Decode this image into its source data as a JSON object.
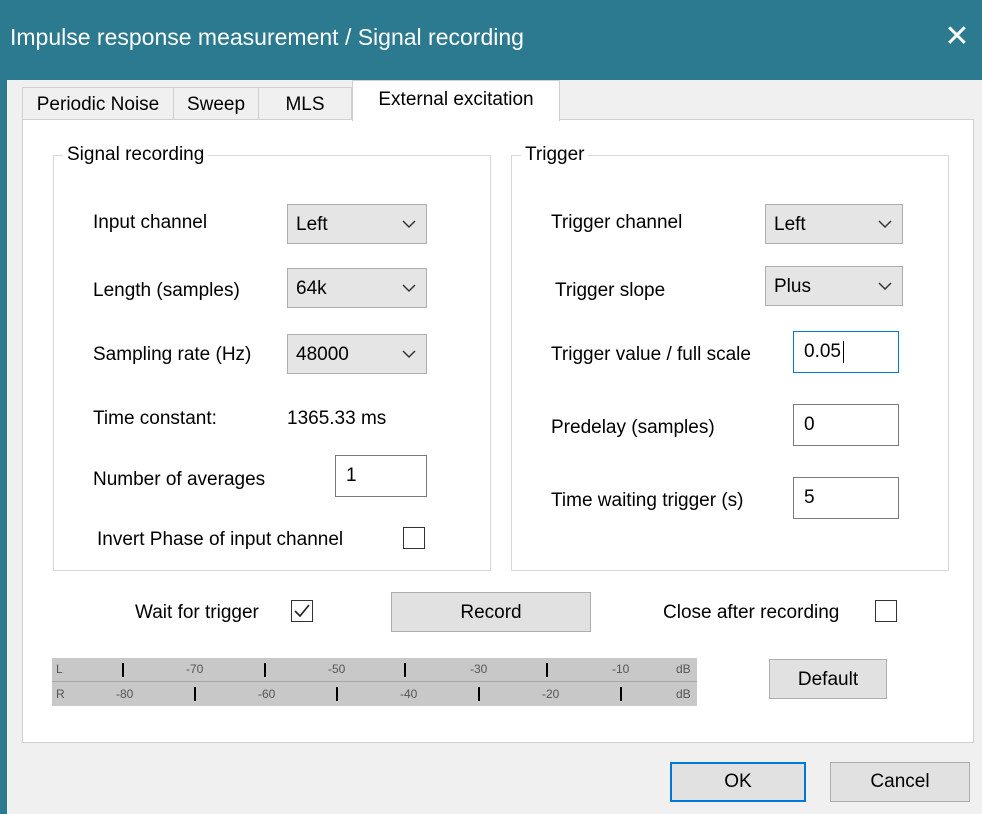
{
  "window": {
    "title": "Impulse response measurement / Signal recording",
    "close_glyph": "✕"
  },
  "tabs": [
    {
      "label": "Periodic Noise"
    },
    {
      "label": "Sweep"
    },
    {
      "label": "MLS"
    },
    {
      "label": "External excitation",
      "active": true
    }
  ],
  "signal_recording": {
    "group_label": "Signal recording",
    "input_channel_label": "Input channel",
    "input_channel_value": "Left",
    "length_label": "Length (samples)",
    "length_value": "64k",
    "sampling_rate_label": "Sampling rate (Hz)",
    "sampling_rate_value": "48000",
    "time_constant_label": "Time constant:",
    "time_constant_value": "1365.33 ms",
    "averages_label": "Number of averages",
    "averages_value": "1",
    "invert_phase_label": "Invert Phase of input channel",
    "invert_phase_checked": false
  },
  "trigger": {
    "group_label": "Trigger",
    "channel_label": "Trigger channel",
    "channel_value": "Left",
    "slope_label": "Trigger slope",
    "slope_value": "Plus",
    "value_label": "Trigger value / full scale",
    "value_value": "0.05",
    "predelay_label": "Predelay (samples)",
    "predelay_value": "0",
    "wait_time_label": "Time waiting trigger (s)",
    "wait_time_value": "5"
  },
  "options": {
    "wait_for_trigger_label": "Wait for trigger",
    "wait_for_trigger_checked": true,
    "record_label": "Record",
    "close_after_label": "Close after recording",
    "close_after_checked": false,
    "default_label": "Default"
  },
  "level_meter": {
    "row_l_label": "L",
    "row_r_label": "R",
    "l_scale": [
      "-70",
      "-50",
      "-30",
      "-10"
    ],
    "r_scale": [
      "-80",
      "-60",
      "-40",
      "-20"
    ],
    "unit": "dB"
  },
  "footer": {
    "ok_label": "OK",
    "cancel_label": "Cancel"
  },
  "colors": {
    "titlebar": "#2b7a8f",
    "focus_blue": "#0078d7"
  }
}
